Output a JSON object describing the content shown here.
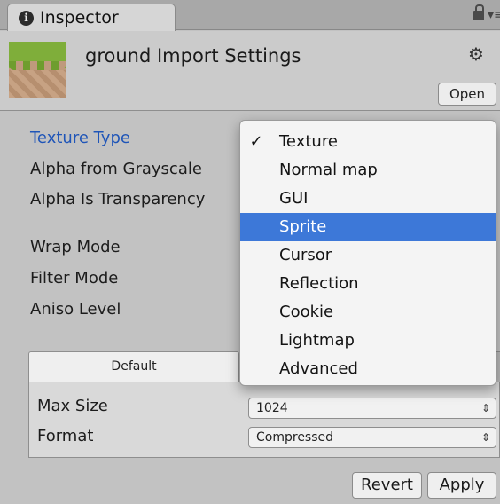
{
  "tab": {
    "label": "Inspector",
    "info_glyph": "i"
  },
  "window_controls": {
    "menu_glyph": "▾≡"
  },
  "header": {
    "title": "ground Import Settings",
    "gear_glyph": "⚙",
    "open_label": "Open"
  },
  "properties": [
    {
      "label": "Texture Type"
    },
    {
      "label": "Alpha from Grayscale"
    },
    {
      "label": "Alpha Is Transparency"
    },
    {
      "label": "Wrap Mode"
    },
    {
      "label": "Filter Mode"
    },
    {
      "label": "Aniso Level"
    }
  ],
  "platform": {
    "tab_label": "Default",
    "rows": [
      {
        "label": "Max Size",
        "value": "1024"
      },
      {
        "label": "Format",
        "value": "Compressed"
      }
    ],
    "arrows": "⇕"
  },
  "buttons": {
    "revert": "Revert",
    "apply": "Apply"
  },
  "dropdown": {
    "check_glyph": "✓",
    "items": [
      {
        "label": "Texture",
        "checked": true,
        "highlighted": false
      },
      {
        "label": "Normal map",
        "checked": false,
        "highlighted": false
      },
      {
        "label": "GUI",
        "checked": false,
        "highlighted": false
      },
      {
        "label": "Sprite",
        "checked": false,
        "highlighted": true
      },
      {
        "label": "Cursor",
        "checked": false,
        "highlighted": false
      },
      {
        "label": "Reflection",
        "checked": false,
        "highlighted": false
      },
      {
        "label": "Cookie",
        "checked": false,
        "highlighted": false
      },
      {
        "label": "Lightmap",
        "checked": false,
        "highlighted": false
      },
      {
        "label": "Advanced",
        "checked": false,
        "highlighted": false
      }
    ]
  },
  "colors": {
    "accent": "#3d78d8",
    "active_label": "#1f55b8",
    "panel": "#c2c2c2"
  }
}
